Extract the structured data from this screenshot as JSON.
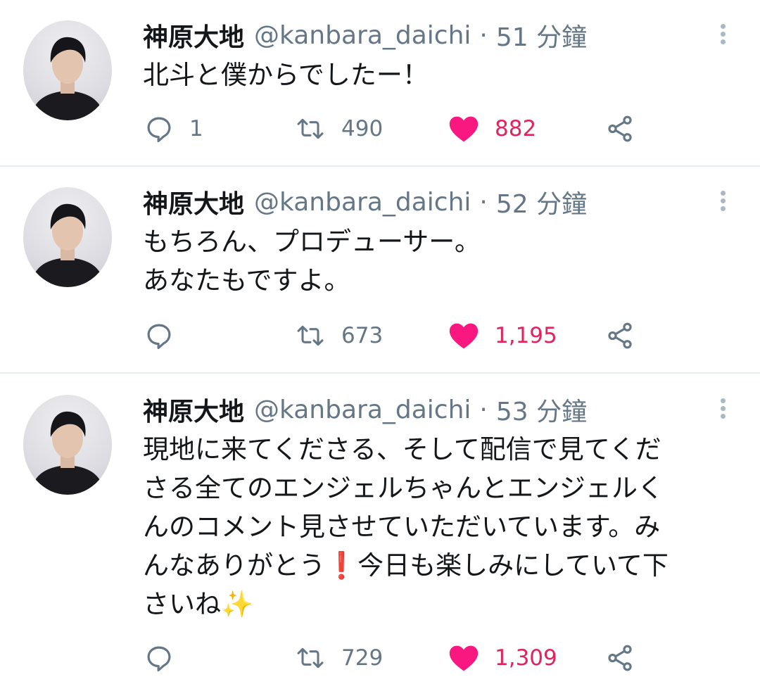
{
  "colors": {
    "like": "#e0245e",
    "muted": "#657786",
    "divider": "#e6ecf0"
  },
  "icons": {
    "reply": "reply-icon",
    "retweet": "retweet-icon",
    "like": "heart-icon",
    "share": "share-icon",
    "more": "more-vertical-icon"
  },
  "tweets": [
    {
      "name": "神原大地",
      "handle": "@kanbara_daichi",
      "sep": "·",
      "time": "51 分鐘",
      "text": "北斗と僕からでしたー！",
      "replies": "1",
      "retweets": "490",
      "likes": "882",
      "liked": true
    },
    {
      "name": "神原大地",
      "handle": "@kanbara_daichi",
      "sep": "·",
      "time": "52 分鐘",
      "text": "もちろん、プロデューサー。\nあなたもですよ。",
      "replies": "",
      "retweets": "673",
      "likes": "1,195",
      "liked": true
    },
    {
      "name": "神原大地",
      "handle": "@kanbara_daichi",
      "sep": "·",
      "time": "53 分鐘",
      "text_parts": [
        "現地に来てくださる、そして配信で見てくだ\nさる全てのエンジェルちゃんとエンジェルく\nんのコメント見させていただいています。み\nんなありがとう",
        "❗",
        "今日も楽しみにしていて下\nさいね",
        "✨"
      ],
      "replies": "",
      "retweets": "729",
      "likes": "1,309",
      "liked": true
    }
  ]
}
